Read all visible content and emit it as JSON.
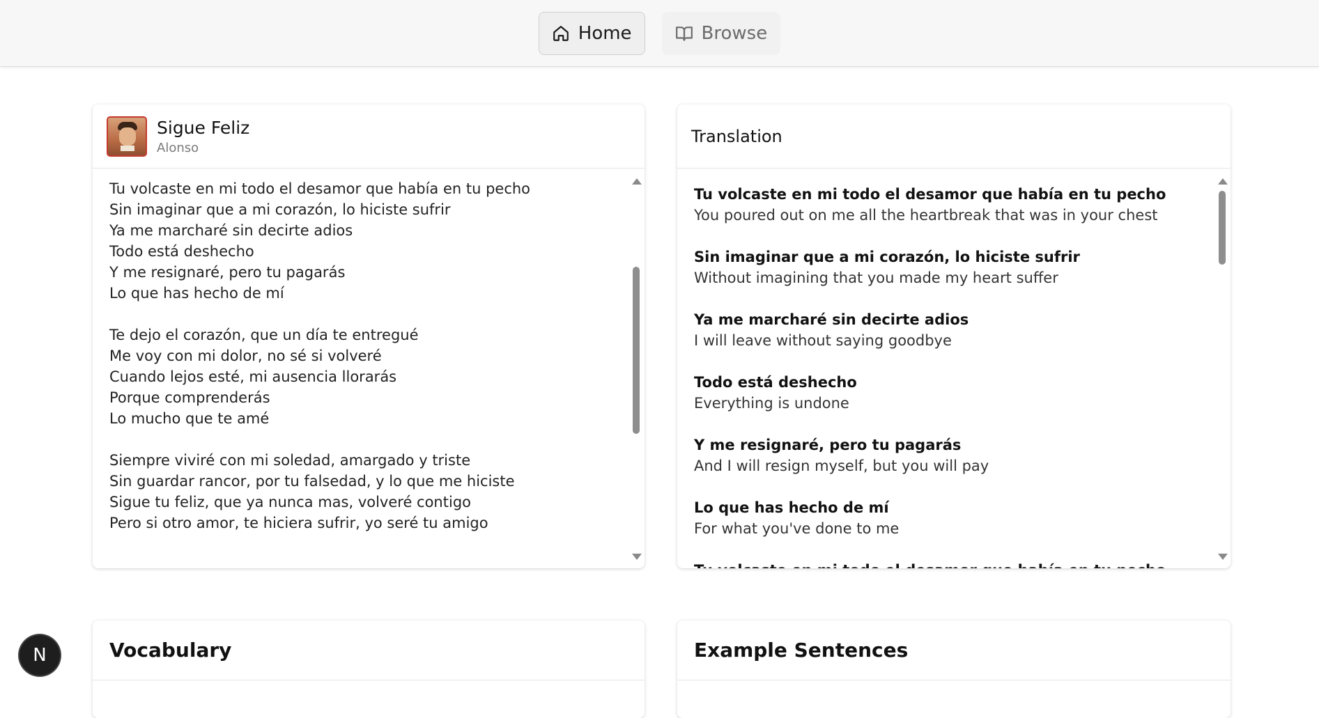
{
  "nav": {
    "home_label": "Home",
    "browse_label": "Browse"
  },
  "song": {
    "title": "Sigue Feliz",
    "artist": "Alonso",
    "stanzas": [
      [
        "Tu volcaste en mi todo el desamor que había en tu pecho",
        "Sin imaginar que a mi corazón, lo hiciste sufrir",
        "Ya me marcharé sin decirte adios",
        "Todo está deshecho",
        "Y me resignaré, pero tu pagarás",
        "Lo que has hecho de mí"
      ],
      [
        "Te dejo el corazón, que un día te entregué",
        "Me voy con mi dolor, no sé si volveré",
        "Cuando lejos esté, mi ausencia llorarás",
        "Porque comprenderás",
        "Lo mucho que te amé"
      ],
      [
        "Siempre viviré con mi soledad, amargado y triste",
        "Sin guardar rancor, por tu falsedad, y lo que me hiciste",
        "Sigue tu feliz, que ya nunca mas, volveré contigo",
        "Pero si otro amor, te hiciera sufrir, yo seré tu amigo"
      ]
    ]
  },
  "translation": {
    "title": "Translation",
    "items": [
      {
        "es": "Tu volcaste en mi todo el desamor que había en tu pecho",
        "en": "You poured out on me all the heartbreak that was in your chest"
      },
      {
        "es": "Sin imaginar que a mi corazón, lo hiciste sufrir",
        "en": "Without imagining that you made my heart suffer"
      },
      {
        "es": "Ya me marcharé sin decirte adios",
        "en": "I will leave without saying goodbye"
      },
      {
        "es": "Todo está deshecho",
        "en": "Everything is undone"
      },
      {
        "es": "Y me resignaré, pero tu pagarás",
        "en": "And I will resign myself, but you will pay"
      },
      {
        "es": "Lo que has hecho de mí",
        "en": "For what you've done to me"
      },
      {
        "es": "Tu volcaste en mi todo el desamor que había en tu pecho",
        "en": ""
      }
    ]
  },
  "sections": {
    "vocabulary_title": "Vocabulary",
    "examples_title": "Example Sentences"
  },
  "badge": {
    "letter": "N"
  }
}
